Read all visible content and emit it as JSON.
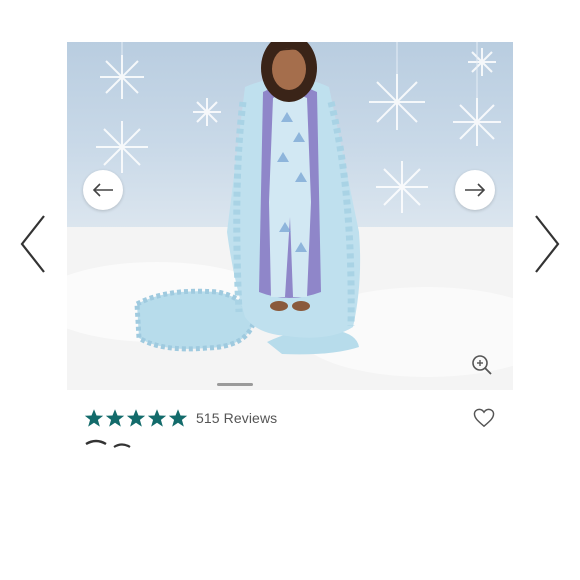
{
  "product": {
    "rating": {
      "stars": 5,
      "max_stars": 5,
      "review_count_label": "515 Reviews"
    }
  },
  "colors": {
    "star": "#136b6b",
    "arrow": "#444444",
    "icon": "#555555",
    "indicator": "#9a9a9a"
  },
  "icons": {
    "outer_prev": "chevron-left-icon",
    "outer_next": "chevron-right-icon",
    "image_prev": "arrow-left-icon",
    "image_next": "arrow-right-icon",
    "zoom": "zoom-in-icon",
    "wishlist": "heart-icon"
  }
}
